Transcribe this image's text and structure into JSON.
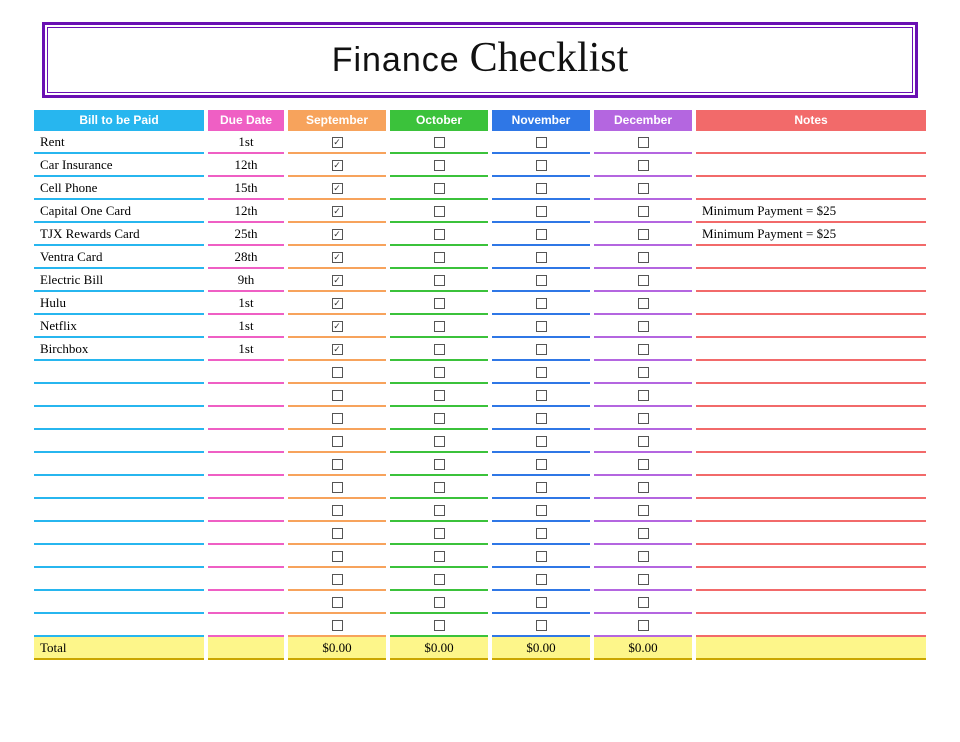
{
  "title": {
    "word1": "Finance",
    "word2": "Checklist"
  },
  "headers": {
    "bill": "Bill to be Paid",
    "due": "Due Date",
    "sep": "September",
    "oct": "October",
    "nov": "November",
    "dec": "December",
    "notes": "Notes"
  },
  "rows": [
    {
      "bill": "Rent",
      "due": "1st",
      "sep": true,
      "oct": false,
      "nov": false,
      "dec": false,
      "notes": ""
    },
    {
      "bill": "Car Insurance",
      "due": "12th",
      "sep": true,
      "oct": false,
      "nov": false,
      "dec": false,
      "notes": ""
    },
    {
      "bill": "Cell Phone",
      "due": "15th",
      "sep": true,
      "oct": false,
      "nov": false,
      "dec": false,
      "notes": ""
    },
    {
      "bill": "Capital One Card",
      "due": "12th",
      "sep": true,
      "oct": false,
      "nov": false,
      "dec": false,
      "notes": "Minimum Payment = $25"
    },
    {
      "bill": "TJX Rewards Card",
      "due": "25th",
      "sep": true,
      "oct": false,
      "nov": false,
      "dec": false,
      "notes": "Minimum Payment = $25"
    },
    {
      "bill": "Ventra Card",
      "due": "28th",
      "sep": true,
      "oct": false,
      "nov": false,
      "dec": false,
      "notes": ""
    },
    {
      "bill": "Electric Bill",
      "due": "9th",
      "sep": true,
      "oct": false,
      "nov": false,
      "dec": false,
      "notes": ""
    },
    {
      "bill": "Hulu",
      "due": "1st",
      "sep": true,
      "oct": false,
      "nov": false,
      "dec": false,
      "notes": ""
    },
    {
      "bill": "Netflix",
      "due": "1st",
      "sep": true,
      "oct": false,
      "nov": false,
      "dec": false,
      "notes": ""
    },
    {
      "bill": "Birchbox",
      "due": "1st",
      "sep": true,
      "oct": false,
      "nov": false,
      "dec": false,
      "notes": ""
    },
    {
      "bill": "",
      "due": "",
      "sep": false,
      "oct": false,
      "nov": false,
      "dec": false,
      "notes": ""
    },
    {
      "bill": "",
      "due": "",
      "sep": false,
      "oct": false,
      "nov": false,
      "dec": false,
      "notes": ""
    },
    {
      "bill": "",
      "due": "",
      "sep": false,
      "oct": false,
      "nov": false,
      "dec": false,
      "notes": ""
    },
    {
      "bill": "",
      "due": "",
      "sep": false,
      "oct": false,
      "nov": false,
      "dec": false,
      "notes": ""
    },
    {
      "bill": "",
      "due": "",
      "sep": false,
      "oct": false,
      "nov": false,
      "dec": false,
      "notes": ""
    },
    {
      "bill": "",
      "due": "",
      "sep": false,
      "oct": false,
      "nov": false,
      "dec": false,
      "notes": ""
    },
    {
      "bill": "",
      "due": "",
      "sep": false,
      "oct": false,
      "nov": false,
      "dec": false,
      "notes": ""
    },
    {
      "bill": "",
      "due": "",
      "sep": false,
      "oct": false,
      "nov": false,
      "dec": false,
      "notes": ""
    },
    {
      "bill": "",
      "due": "",
      "sep": false,
      "oct": false,
      "nov": false,
      "dec": false,
      "notes": ""
    },
    {
      "bill": "",
      "due": "",
      "sep": false,
      "oct": false,
      "nov": false,
      "dec": false,
      "notes": ""
    },
    {
      "bill": "",
      "due": "",
      "sep": false,
      "oct": false,
      "nov": false,
      "dec": false,
      "notes": ""
    },
    {
      "bill": "",
      "due": "",
      "sep": false,
      "oct": false,
      "nov": false,
      "dec": false,
      "notes": ""
    }
  ],
  "total": {
    "label": "Total",
    "sep": "$0.00",
    "oct": "$0.00",
    "nov": "$0.00",
    "dec": "$0.00"
  }
}
